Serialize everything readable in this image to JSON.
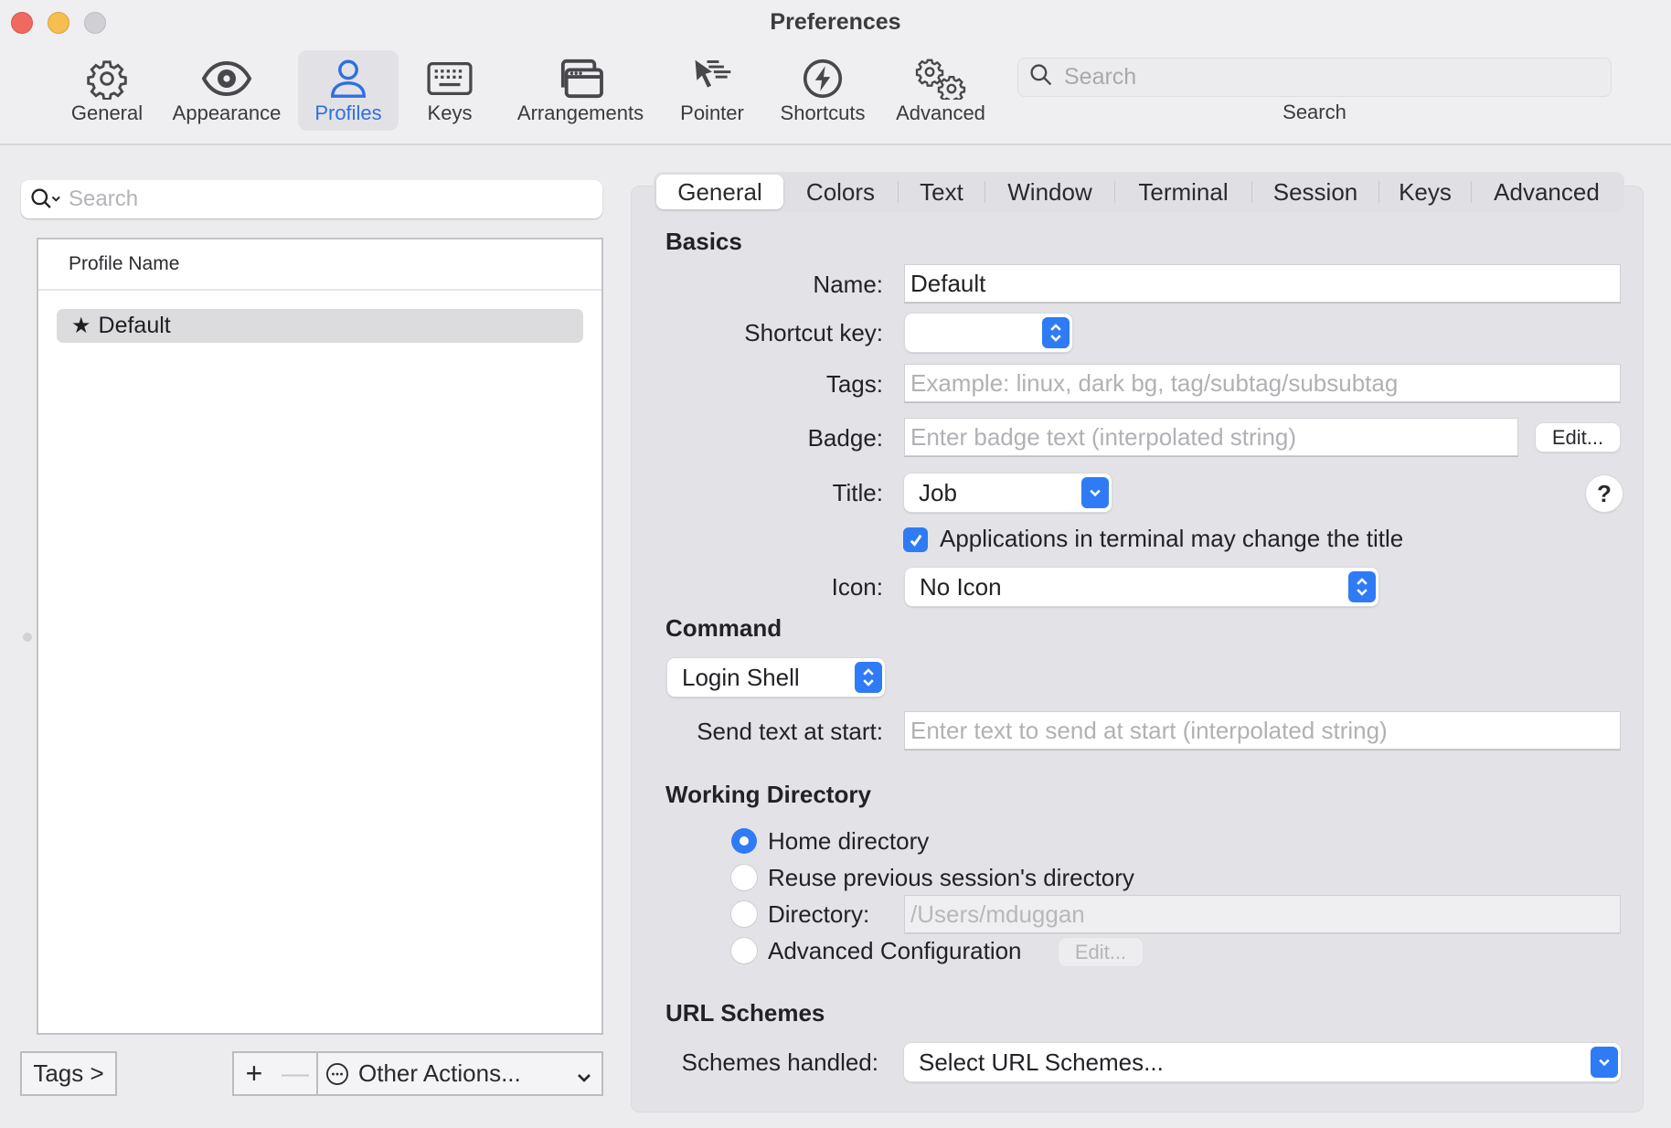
{
  "window": {
    "title": "Preferences",
    "controls": [
      "close",
      "minimize",
      "zoom"
    ]
  },
  "toolbar": {
    "items": [
      {
        "label": "General",
        "icon": "gear-icon",
        "selected": false
      },
      {
        "label": "Appearance",
        "icon": "eye-icon",
        "selected": false
      },
      {
        "label": "Profiles",
        "icon": "person-icon",
        "selected": true
      },
      {
        "label": "Keys",
        "icon": "keyboard-icon",
        "selected": false
      },
      {
        "label": "Arrangements",
        "icon": "windows-icon",
        "selected": false
      },
      {
        "label": "Pointer",
        "icon": "pointer-icon",
        "selected": false
      },
      {
        "label": "Shortcuts",
        "icon": "bolt-icon",
        "selected": false
      },
      {
        "label": "Advanced",
        "icon": "gears-icon",
        "selected": false
      }
    ],
    "search": {
      "placeholder": "Search",
      "value": "",
      "label": "Search"
    }
  },
  "profiles_pane": {
    "search_placeholder": "Search",
    "column_header": "Profile Name",
    "profiles": [
      {
        "name": "Default",
        "is_default": true,
        "selected": true
      }
    ],
    "tags_button": "Tags >",
    "add_button": "+",
    "remove_button": "—",
    "other_actions_button": "Other Actions..."
  },
  "settings": {
    "tabs": [
      {
        "label": "General",
        "active": true
      },
      {
        "label": "Colors",
        "active": false
      },
      {
        "label": "Text",
        "active": false
      },
      {
        "label": "Window",
        "active": false
      },
      {
        "label": "Terminal",
        "active": false
      },
      {
        "label": "Session",
        "active": false
      },
      {
        "label": "Keys",
        "active": false
      },
      {
        "label": "Advanced",
        "active": false
      }
    ],
    "basics": {
      "title": "Basics",
      "name_label": "Name:",
      "name_value": "Default",
      "shortcut_label": "Shortcut key:",
      "shortcut_value": "",
      "tags_label": "Tags:",
      "tags_placeholder": "Example: linux, dark bg, tag/subtag/subsubtag",
      "tags_value": "",
      "badge_label": "Badge:",
      "badge_placeholder": "Enter badge text (interpolated string)",
      "badge_value": "",
      "badge_edit_button": "Edit...",
      "title_label": "Title:",
      "title_value": "Job",
      "help_button": "?",
      "apps_change_title_label": "Applications in terminal may change the title",
      "apps_change_title_checked": true,
      "icon_label": "Icon:",
      "icon_value": "No Icon"
    },
    "command": {
      "title": "Command",
      "command_value": "Login Shell",
      "send_text_label": "Send text at start:",
      "send_text_placeholder": "Enter text to send at start (interpolated string)",
      "send_text_value": ""
    },
    "working_directory": {
      "title": "Working Directory",
      "options": [
        {
          "label": "Home directory",
          "selected": true
        },
        {
          "label": "Reuse previous session's directory",
          "selected": false
        },
        {
          "label": "Directory:",
          "selected": false
        },
        {
          "label": "Advanced Configuration",
          "selected": false
        }
      ],
      "directory_placeholder": "/Users/mduggan",
      "advanced_edit_button": "Edit..."
    },
    "url_schemes": {
      "title": "URL Schemes",
      "schemes_label": "Schemes handled:",
      "schemes_value": "Select URL Schemes..."
    }
  },
  "colors": {
    "accent": "#2f7bf5",
    "selected_toolbar_text": "#2f6fe0",
    "close": "#ee6a5f",
    "minimize": "#f5be4f",
    "zoom_disabled": "#d0d0d4"
  }
}
